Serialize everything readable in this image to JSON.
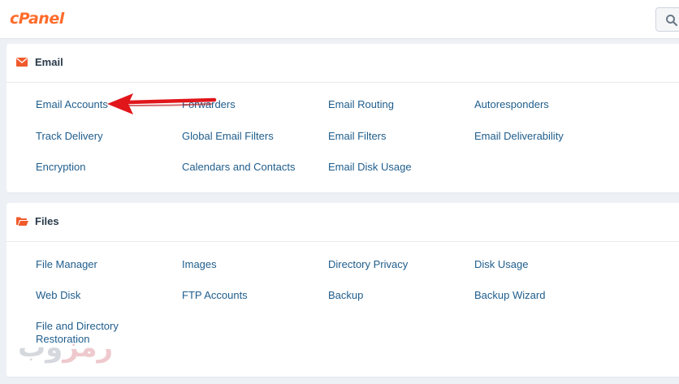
{
  "header": {
    "logo_text": "cPanel",
    "search_icon": "search-icon"
  },
  "sections": {
    "email": {
      "title": "Email",
      "icon": "envelope-icon",
      "items": [
        "Email Accounts",
        "Forwarders",
        "Email Routing",
        "Autoresponders",
        "Track Delivery",
        "Global Email Filters",
        "Email Filters",
        "Email Deliverability",
        "Encryption",
        "Calendars and Contacts",
        "Email Disk Usage"
      ]
    },
    "files": {
      "title": "Files",
      "icon": "folder-open-icon",
      "items": [
        "File Manager",
        "Images",
        "Directory Privacy",
        "Disk Usage",
        "Web Disk",
        "FTP Accounts",
        "Backup",
        "Backup Wizard",
        "File and Directory Restoration"
      ]
    }
  },
  "annotation": {
    "arrow_color": "#e0161b",
    "arrow_target": "Email Accounts"
  },
  "watermark": {
    "part1": "وب",
    "part2": "رمز"
  },
  "colors": {
    "link": "#1f5d8c",
    "accent": "#ff6c2c",
    "section_icon": "#f05b2c",
    "background": "#edf0f4"
  }
}
